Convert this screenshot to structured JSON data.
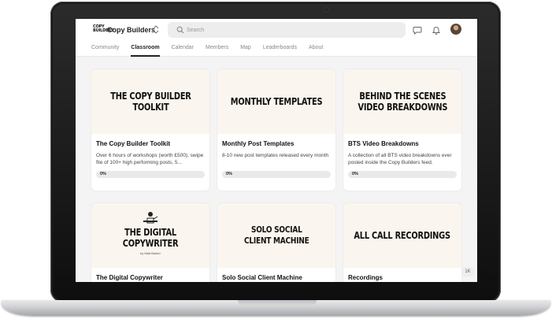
{
  "header": {
    "logo_text": "COPY BUILDERS",
    "brand_name": "Copy Builders",
    "brand_switch_icon": "chevron-up-down-icon",
    "search_placeholder": "Search",
    "icons": [
      "chat-icon",
      "bell-icon",
      "avatar"
    ]
  },
  "tabs": [
    {
      "label": "Community",
      "active": false
    },
    {
      "label": "Classroom",
      "active": true
    },
    {
      "label": "Calendar",
      "active": false
    },
    {
      "label": "Members",
      "active": false
    },
    {
      "label": "Map",
      "active": false
    },
    {
      "label": "Leaderboards",
      "active": false
    },
    {
      "label": "About",
      "active": false
    }
  ],
  "courses": [
    {
      "cover_title": "THE COPY BUILDER\nTOOLKIT",
      "title": "The Copy Builder Toolkit",
      "description": "Over 6 hours of workshops (worth £500), swipe file of 100+ high performing posts, 5...",
      "progress": "0%"
    },
    {
      "cover_title": "MONTHLY TEMPLATES",
      "title": "Monthly Post Templates",
      "description": "8-10 new post templates released every month",
      "progress": "0%"
    },
    {
      "cover_title": "BEHIND THE SCENES\nVIDEO BREAKDOWNS",
      "title": "BTS Video Breakdowns",
      "description": "A collection of all BTS video breakdowns ever posted inside the Copy Builders feed.",
      "progress": "0%"
    },
    {
      "cover_title": "THE DIGITAL\nCOPYWRITER",
      "cover_subtitle": "by Matt Barker",
      "title": "The Digital Copywriter"
    },
    {
      "cover_title": "SOLO SOCIAL\nCLIENT MACHINE",
      "title": "Solo Social Client Machine"
    },
    {
      "cover_title": "ALL CALL RECORDINGS",
      "title": "Recordings"
    }
  ],
  "corner_badge": "1K",
  "colors": {
    "accent": "#222222",
    "cover_bg": "#faf5ee",
    "page_bg": "#f4f4f4",
    "progress_bg": "#e9e9e9"
  }
}
